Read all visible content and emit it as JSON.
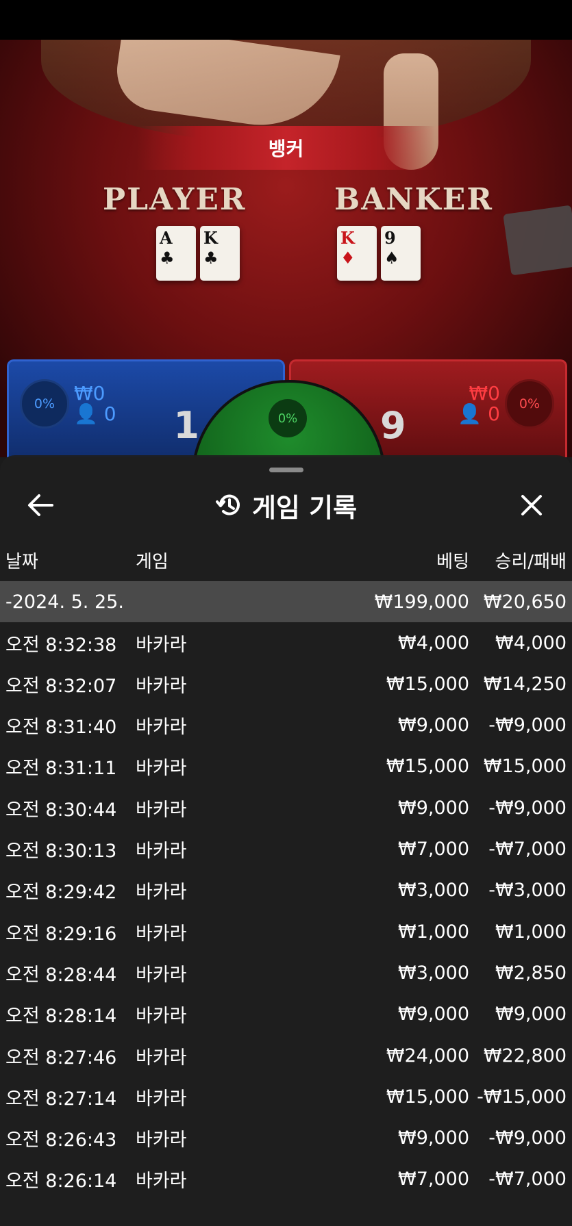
{
  "table": {
    "result_banner": "뱅커",
    "player_label": "PLAYER",
    "banker_label": "BANKER",
    "player_cards": [
      {
        "rank": "A",
        "suit": "♣",
        "color": "black"
      },
      {
        "rank": "K",
        "suit": "♣",
        "color": "black"
      }
    ],
    "banker_cards": [
      {
        "rank": "K",
        "suit": "♦",
        "color": "red"
      },
      {
        "rank": "9",
        "suit": "♠",
        "color": "black"
      }
    ],
    "player_panel": {
      "percent": "0%",
      "amount": "₩0",
      "players": "0",
      "score": "1"
    },
    "banker_panel": {
      "percent": "0%",
      "amount": "₩0",
      "players": "0",
      "score": "9"
    },
    "tie_percent": "0%"
  },
  "history": {
    "title": "게임 기록",
    "icons": {
      "back": "arrow-left-icon",
      "history": "history-clock-icon",
      "close": "close-icon"
    },
    "columns": {
      "date": "날짜",
      "game": "게임",
      "bet": "베팅",
      "win_loss": "승리/패배"
    },
    "date_group": {
      "date": "-2024. 5. 25.",
      "bet_total": "₩199,000",
      "win_total": "₩20,650"
    },
    "rows": [
      {
        "time": "오전 8:32:38",
        "game": "바카라",
        "bet": "₩4,000",
        "result": "₩4,000"
      },
      {
        "time": "오전 8:32:07",
        "game": "바카라",
        "bet": "₩15,000",
        "result": "₩14,250"
      },
      {
        "time": "오전 8:31:40",
        "game": "바카라",
        "bet": "₩9,000",
        "result": "-₩9,000"
      },
      {
        "time": "오전 8:31:11",
        "game": "바카라",
        "bet": "₩15,000",
        "result": "₩15,000"
      },
      {
        "time": "오전 8:30:44",
        "game": "바카라",
        "bet": "₩9,000",
        "result": "-₩9,000"
      },
      {
        "time": "오전 8:30:13",
        "game": "바카라",
        "bet": "₩7,000",
        "result": "-₩7,000"
      },
      {
        "time": "오전 8:29:42",
        "game": "바카라",
        "bet": "₩3,000",
        "result": "-₩3,000"
      },
      {
        "time": "오전 8:29:16",
        "game": "바카라",
        "bet": "₩1,000",
        "result": "₩1,000"
      },
      {
        "time": "오전 8:28:44",
        "game": "바카라",
        "bet": "₩3,000",
        "result": "₩2,850"
      },
      {
        "time": "오전 8:28:14",
        "game": "바카라",
        "bet": "₩9,000",
        "result": "₩9,000"
      },
      {
        "time": "오전 8:27:46",
        "game": "바카라",
        "bet": "₩24,000",
        "result": "₩22,800"
      },
      {
        "time": "오전 8:27:14",
        "game": "바카라",
        "bet": "₩15,000",
        "result": "-₩15,000"
      },
      {
        "time": "오전 8:26:43",
        "game": "바카라",
        "bet": "₩9,000",
        "result": "-₩9,000"
      },
      {
        "time": "오전 8:26:14",
        "game": "바카라",
        "bet": "₩7,000",
        "result": "-₩7,000"
      }
    ]
  }
}
